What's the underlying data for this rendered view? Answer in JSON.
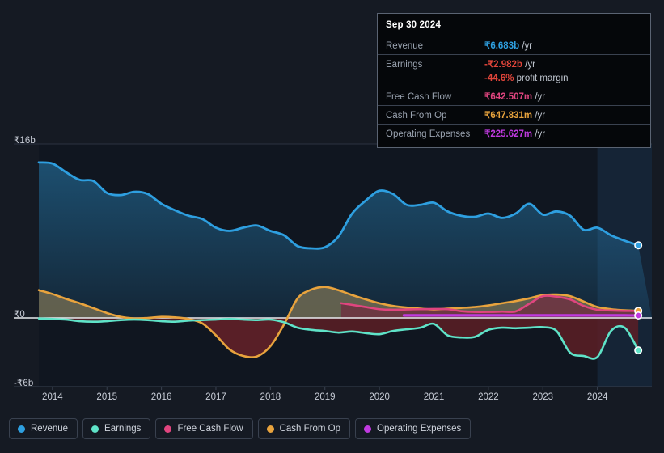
{
  "theme": {
    "background": "#151a23",
    "plot_background": "#101620",
    "forecast_band": "#152233",
    "grid": "#2c3340",
    "axis_line": "#c9ced8",
    "text": "#c9ced8"
  },
  "axes": {
    "y_ticks": [
      {
        "label": "₹16b",
        "value": 16
      },
      {
        "label": "₹0",
        "value": 0
      },
      {
        "label": "-₹6b",
        "value": -6
      }
    ],
    "x_ticks": [
      "2014",
      "2015",
      "2016",
      "2017",
      "2018",
      "2019",
      "2020",
      "2021",
      "2022",
      "2023",
      "2024"
    ]
  },
  "tooltip": {
    "title": "Sep 30 2024",
    "rows": [
      {
        "key": "Revenue",
        "value": "₹6.683b",
        "unit": "/yr",
        "color": "#2e9fe0"
      },
      {
        "key": "Earnings",
        "value": "-₹2.982b",
        "unit": "/yr",
        "color": "#e0453a"
      },
      {
        "key": "",
        "value": "-44.6%",
        "unit": "profit margin",
        "color": "#e0453a",
        "rule": false
      },
      {
        "key": "Free Cash Flow",
        "value": "₹642.507m",
        "unit": "/yr",
        "color": "#e0457f"
      },
      {
        "key": "Cash From Op",
        "value": "₹647.831m",
        "unit": "/yr",
        "color": "#e8a33d"
      },
      {
        "key": "Operating Expenses",
        "value": "₹225.627m",
        "unit": "/yr",
        "color": "#c03ae0"
      }
    ]
  },
  "legend": {
    "items": [
      {
        "label": "Revenue",
        "color": "#2e9fe0"
      },
      {
        "label": "Earnings",
        "color": "#5fe3c8"
      },
      {
        "label": "Free Cash Flow",
        "color": "#e0457f"
      },
      {
        "label": "Cash From Op",
        "color": "#e8a33d"
      },
      {
        "label": "Operating Expenses",
        "color": "#c03ae0"
      }
    ]
  },
  "chart_data": {
    "type": "area",
    "title": "",
    "xlabel": "",
    "ylabel": "",
    "currency": "INR",
    "xlim": [
      2013.75,
      2025.0
    ],
    "ylim": [
      -6.2,
      16.0
    ],
    "grid": true,
    "legend_position": "bottom",
    "forecast_start": 2024.0,
    "x": [
      2013.75,
      2014.0,
      2014.25,
      2014.5,
      2014.75,
      2015.0,
      2015.25,
      2015.5,
      2015.75,
      2016.0,
      2016.25,
      2016.5,
      2016.75,
      2017.0,
      2017.25,
      2017.5,
      2017.75,
      2018.0,
      2018.25,
      2018.5,
      2018.75,
      2019.0,
      2019.25,
      2019.5,
      2019.75,
      2020.0,
      2020.25,
      2020.5,
      2020.75,
      2021.0,
      2021.25,
      2021.5,
      2021.75,
      2022.0,
      2022.25,
      2022.5,
      2022.75,
      2023.0,
      2023.25,
      2023.5,
      2023.75,
      2024.0,
      2024.25,
      2024.5,
      2024.75
    ],
    "series": [
      {
        "name": "Revenue",
        "color": "#2e9fe0",
        "unit": "INR b",
        "values": [
          14.3,
          14.2,
          13.4,
          12.7,
          12.6,
          11.5,
          11.3,
          11.6,
          11.4,
          10.5,
          9.9,
          9.4,
          9.1,
          8.3,
          8.0,
          8.3,
          8.5,
          8.0,
          7.6,
          6.6,
          6.4,
          6.5,
          7.5,
          9.6,
          10.8,
          11.7,
          11.4,
          10.4,
          10.4,
          10.6,
          9.8,
          9.4,
          9.3,
          9.6,
          9.2,
          9.6,
          10.5,
          9.5,
          9.8,
          9.4,
          8.1,
          8.3,
          7.6,
          7.1,
          6.683
        ]
      },
      {
        "name": "Earnings",
        "color": "#5fe3c8",
        "unit": "INR b",
        "values": [
          -0.05,
          -0.1,
          -0.15,
          -0.3,
          -0.35,
          -0.3,
          -0.2,
          -0.15,
          -0.2,
          -0.3,
          -0.35,
          -0.25,
          -0.2,
          -0.15,
          -0.1,
          -0.15,
          -0.2,
          -0.15,
          -0.4,
          -0.9,
          -1.1,
          -1.2,
          -1.35,
          -1.25,
          -1.4,
          -1.5,
          -1.2,
          -1.05,
          -0.9,
          -0.55,
          -1.6,
          -1.8,
          -1.75,
          -1.1,
          -0.9,
          -0.95,
          -0.9,
          -0.85,
          -1.2,
          -3.2,
          -3.5,
          -3.6,
          -1.2,
          -0.9,
          -2.982
        ]
      },
      {
        "name": "Free Cash Flow",
        "color": "#e0457f",
        "unit": "INR b",
        "start_x": 2019.3,
        "values": [
          null,
          null,
          null,
          null,
          null,
          null,
          null,
          null,
          null,
          null,
          null,
          null,
          null,
          null,
          null,
          null,
          null,
          null,
          null,
          null,
          null,
          null,
          1.35,
          1.2,
          1.0,
          0.8,
          0.75,
          0.78,
          0.8,
          0.82,
          0.8,
          0.62,
          0.55,
          0.55,
          0.58,
          0.6,
          1.3,
          2.0,
          1.95,
          1.7,
          1.1,
          0.75,
          0.68,
          0.65,
          0.642507
        ]
      },
      {
        "name": "Cash From Op",
        "color": "#e8a33d",
        "unit": "INR b",
        "values": [
          2.55,
          2.2,
          1.75,
          1.35,
          0.9,
          0.45,
          0.1,
          -0.05,
          0.0,
          0.1,
          0.05,
          -0.1,
          -0.5,
          -1.6,
          -2.9,
          -3.5,
          -3.55,
          -2.6,
          -0.6,
          1.8,
          2.6,
          2.85,
          2.55,
          2.1,
          1.7,
          1.35,
          1.1,
          0.95,
          0.85,
          0.78,
          0.85,
          0.92,
          1.0,
          1.15,
          1.35,
          1.55,
          1.8,
          2.1,
          2.15,
          2.0,
          1.5,
          1.0,
          0.8,
          0.7,
          0.647831
        ]
      },
      {
        "name": "Operating Expenses",
        "color": "#c03ae0",
        "unit": "INR b",
        "start_x": 2020.45,
        "values": [
          null,
          null,
          null,
          null,
          null,
          null,
          null,
          null,
          null,
          null,
          null,
          null,
          null,
          null,
          null,
          null,
          null,
          null,
          null,
          null,
          null,
          null,
          null,
          null,
          null,
          null,
          0.23,
          0.23,
          0.23,
          0.23,
          0.23,
          0.23,
          0.23,
          0.23,
          0.23,
          0.23,
          0.23,
          0.23,
          0.23,
          0.23,
          0.23,
          0.23,
          0.23,
          0.23,
          0.225627
        ]
      }
    ]
  }
}
